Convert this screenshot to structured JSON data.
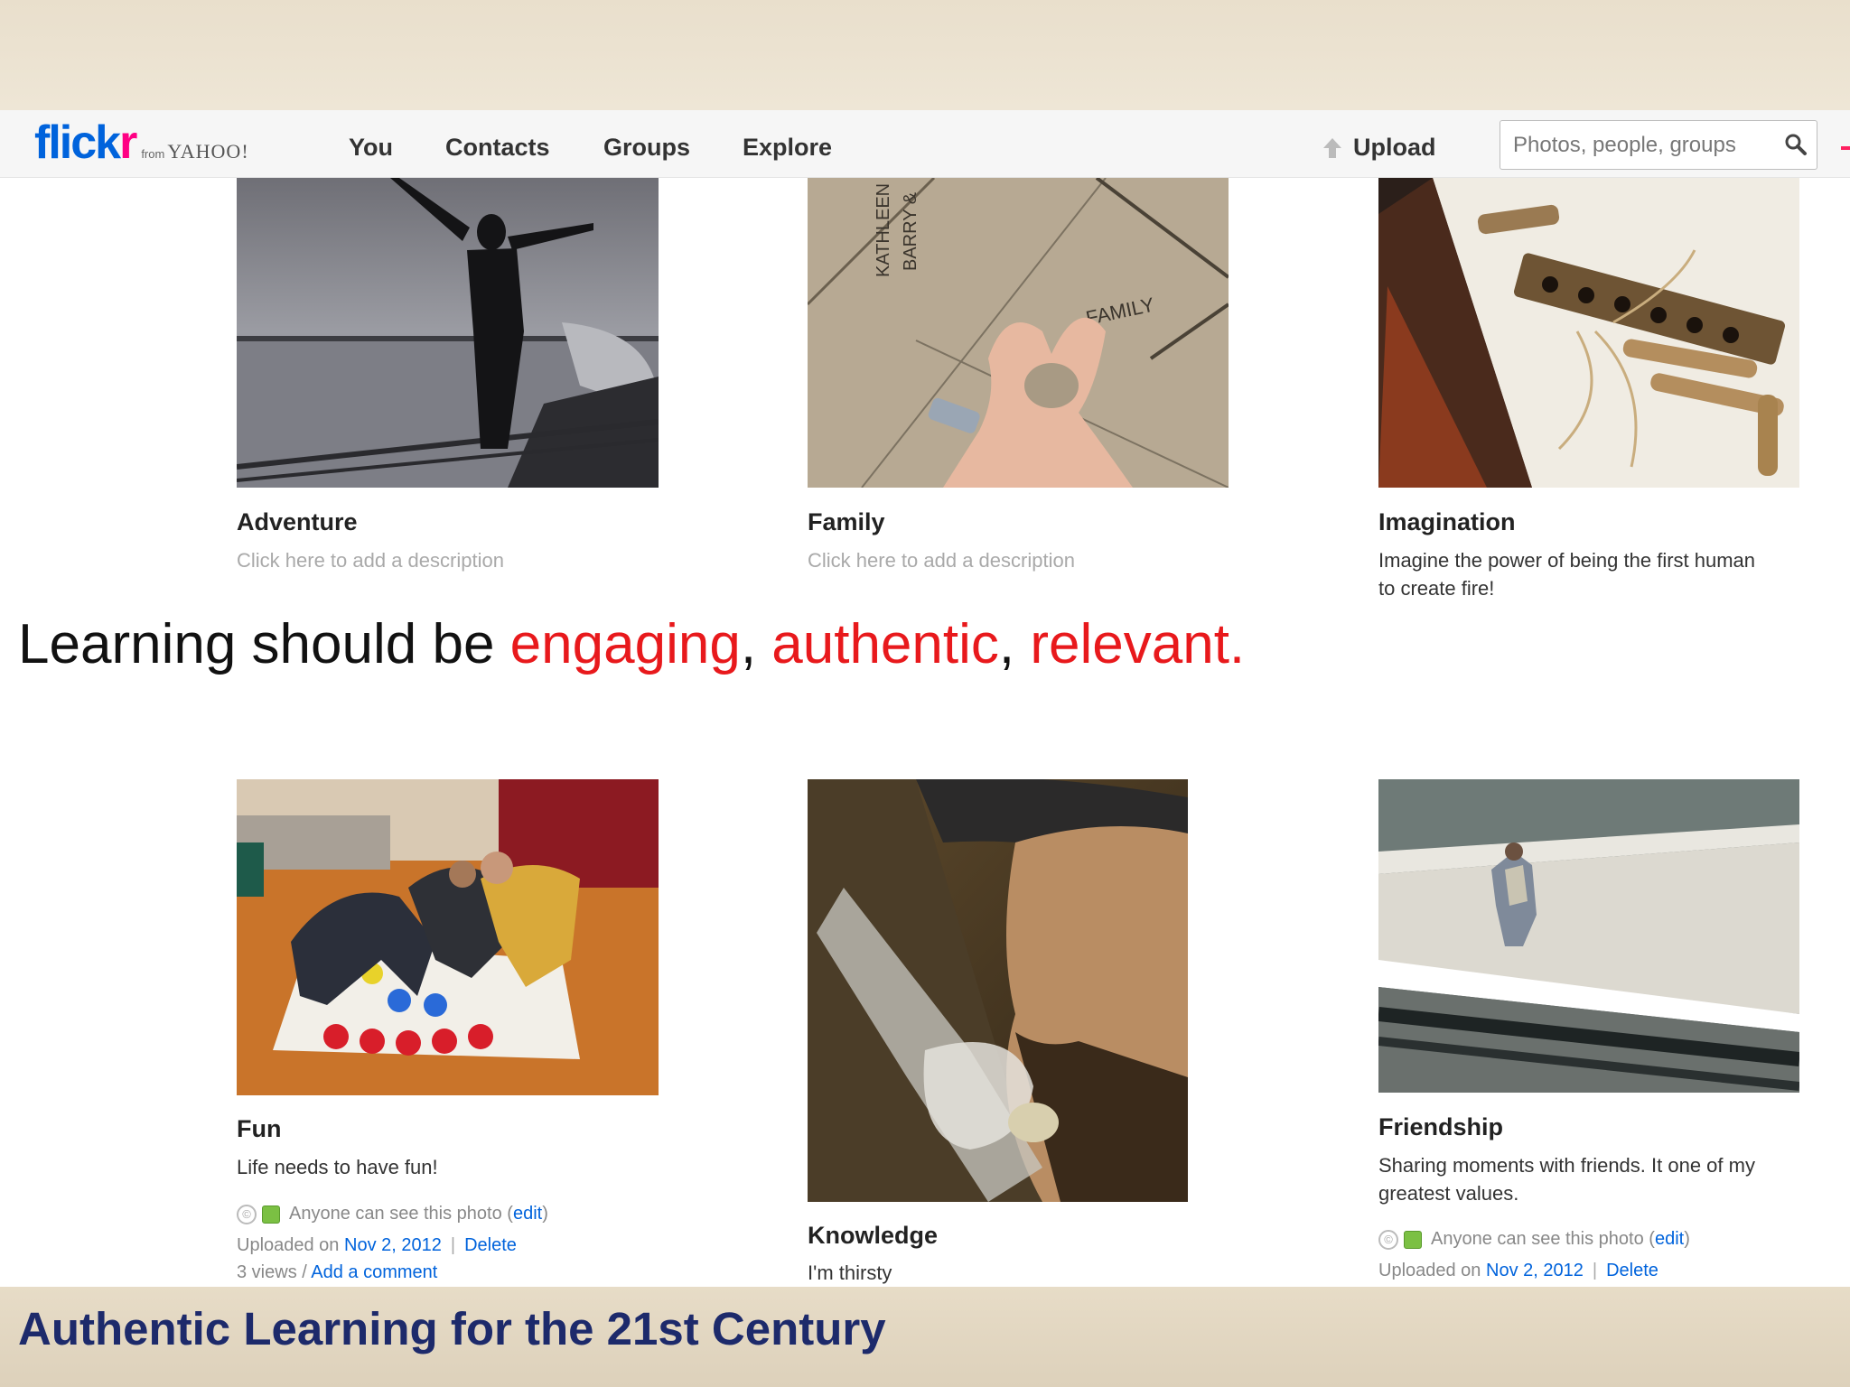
{
  "nav": {
    "logo_main": "flick",
    "logo_r": "r",
    "logo_from": "from",
    "logo_yahoo": "YAHOO!",
    "items": [
      "You",
      "Contacts",
      "Groups",
      "Explore"
    ],
    "upload_label": "Upload",
    "search_placeholder": "Photos, people, groups"
  },
  "photos": [
    {
      "title": "Adventure",
      "description": "Click here to add a description"
    },
    {
      "title": "Family",
      "description": "Click here to add a description",
      "floor_text_1": "KATHLEEN",
      "floor_text_2": "BARRY &",
      "floor_text_3": "FAMILY"
    },
    {
      "title": "Imagination",
      "description_line1": "Imagine the power of being the first human",
      "description_line2": "to create fire!"
    },
    {
      "title": "Fun",
      "description": "Life needs to have fun!",
      "visibility": "Anyone can see this photo",
      "edit": "edit",
      "uploaded_on": "Uploaded on",
      "date": "Nov 2, 2012",
      "delete": "Delete",
      "views": "3 views /",
      "add_comment": "Add a comment"
    },
    {
      "title": "Knowledge",
      "description": "I'm thirsty"
    },
    {
      "title": "Friendship",
      "description_line1": "Sharing moments with friends. It one of my",
      "description_line2": "greatest values.",
      "visibility": "Anyone can see this photo",
      "edit": "edit",
      "uploaded_on": "Uploaded on",
      "date": "Nov 2, 2012",
      "delete": "Delete"
    }
  ],
  "slide": {
    "headline_prefix": "Learning should be ",
    "word1": "engaging",
    "comma1": ", ",
    "word2": "authentic",
    "comma2": ", ",
    "word3": "relevant.",
    "footer": "Authentic Learning for the 21st Century"
  },
  "colors": {
    "flickr_blue": "#0063dc",
    "flickr_pink": "#ff0084",
    "accent_red": "#e8191c",
    "footer_navy": "#1d2a6b"
  }
}
